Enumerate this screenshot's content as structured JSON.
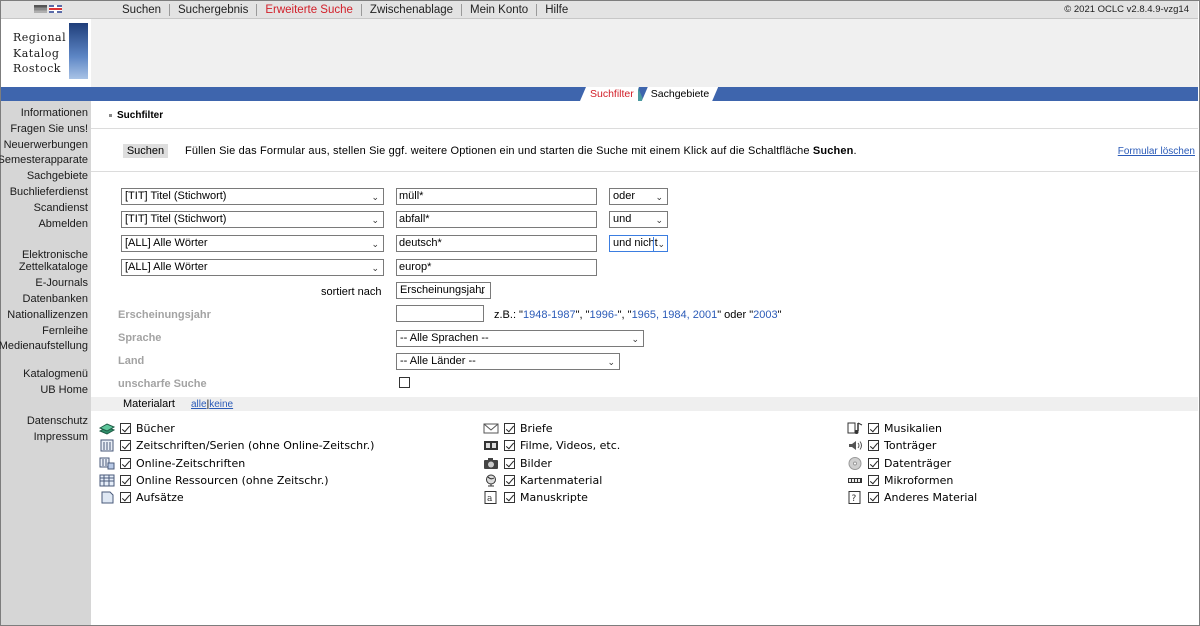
{
  "topbar": {
    "menu": [
      "Suchen",
      "Suchergebnis",
      "Erweiterte Suche",
      "Zwischenablage",
      "Mein Konto",
      "Hilfe"
    ],
    "active_index": 2,
    "copyright": "© 2021 OCLC v2.8.4.9-vzg14"
  },
  "logo": {
    "line1": "Regional",
    "line2": "Katalog",
    "line3": "Rostock"
  },
  "tabs": {
    "active": "Suchfilter",
    "other": "Sachgebiete"
  },
  "sidebar": {
    "items": [
      "Informationen",
      "Fragen Sie uns!",
      "Neuerwerbungen",
      "Semesterapparate",
      "Sachgebiete",
      "Buchlieferdienst",
      "Scandienst",
      "Abmelden",
      "Elektronische",
      "Zettelkataloge",
      "E-Journals",
      "Datenbanken",
      "Nationallizenzen",
      "Fernleihe",
      "Medienaufstellung",
      "Katalogmenü",
      "UB Home",
      "Datenschutz",
      "Impressum"
    ]
  },
  "main": {
    "section_title": "Suchfilter",
    "search_button": "Suchen",
    "instructions_prefix": "Füllen Sie das Formular aus, stellen Sie ggf. weitere Optionen ein und starten die Suche mit einem Klick auf die Schaltfläche ",
    "instructions_bold": "Suchen",
    "instructions_suffix": ".",
    "reset_link": "Formular löschen",
    "rows": [
      {
        "field": "[TIT] Titel (Stichwort)",
        "value": "müll*",
        "op": "oder"
      },
      {
        "field": "[TIT] Titel (Stichwort)",
        "value": "abfall*",
        "op": "und"
      },
      {
        "field": "[ALL] Alle Wörter",
        "value": "deutsch*",
        "op": "und nicht"
      },
      {
        "field": "[ALL] Alle Wörter",
        "value": "europ*",
        "op": ""
      }
    ],
    "sorted_label": "sortiert nach",
    "sorted_value": "Erscheinungsjahr",
    "year_label": "Erscheinungsjahr",
    "year_value": "",
    "example_prefix": "z.B.: \"",
    "example_1": "1948-1987",
    "example_sep1": "\", \"",
    "example_2": "1996-",
    "example_sep2": "\", \"",
    "example_3": "1965, 1984, 2001",
    "example_sep3": "\" oder \"",
    "example_4": "2003",
    "example_suffix": "\"",
    "language_label": "Sprache",
    "language_value": "-- Alle Sprachen --",
    "country_label": "Land",
    "country_value": "-- Alle Länder --",
    "fuzzy_label": "unscharfe Suche",
    "material_title": "Materialart",
    "material_all": "alle",
    "material_none": "keine",
    "materials": [
      {
        "label": "Bücher",
        "icon": "book-icon"
      },
      {
        "label": "Zeitschriften/Serien (ohne Online-Zeitschr.)",
        "icon": "journal-icon"
      },
      {
        "label": "Online-Zeitschriften",
        "icon": "online-journal-icon"
      },
      {
        "label": "Online Ressourcen (ohne Zeitschr.)",
        "icon": "online-resource-icon"
      },
      {
        "label": "Aufsätze",
        "icon": "article-icon"
      },
      {
        "label": "Briefe",
        "icon": "letter-icon"
      },
      {
        "label": "Filme, Videos, etc.",
        "icon": "film-icon"
      },
      {
        "label": "Bilder",
        "icon": "camera-icon"
      },
      {
        "label": "Kartenmaterial",
        "icon": "globe-icon"
      },
      {
        "label": "Manuskripte",
        "icon": "manuscript-icon"
      },
      {
        "label": "Musikalien",
        "icon": "music-icon"
      },
      {
        "label": "Tonträger",
        "icon": "speaker-icon"
      },
      {
        "label": "Datenträger",
        "icon": "disc-icon"
      },
      {
        "label": "Mikroformen",
        "icon": "microform-icon"
      },
      {
        "label": "Anderes Material",
        "icon": "question-icon"
      }
    ]
  }
}
